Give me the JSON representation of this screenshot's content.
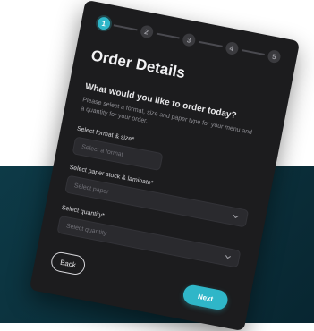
{
  "stepper": {
    "steps": [
      "1",
      "2",
      "3",
      "4",
      "5"
    ],
    "active_step": 1
  },
  "form": {
    "title": "Order Details",
    "question": "What would you like to order today?",
    "description": "Please select a format, size and paper type for your menu and a quantity for your order.",
    "format_label": "Select format & size*",
    "format_placeholder": "Select a format",
    "paper_label": "Select paper stock & laminate*",
    "paper_placeholder": "Select paper",
    "quantity_label": "Select quantity*",
    "quantity_placeholder": "Select quantity"
  },
  "actions": {
    "back_label": "Back",
    "next_label": "Next"
  },
  "colors": {
    "accent": "#2fb6c8",
    "card": "#1c1c1e",
    "backdrop": "#0b2f3a"
  }
}
